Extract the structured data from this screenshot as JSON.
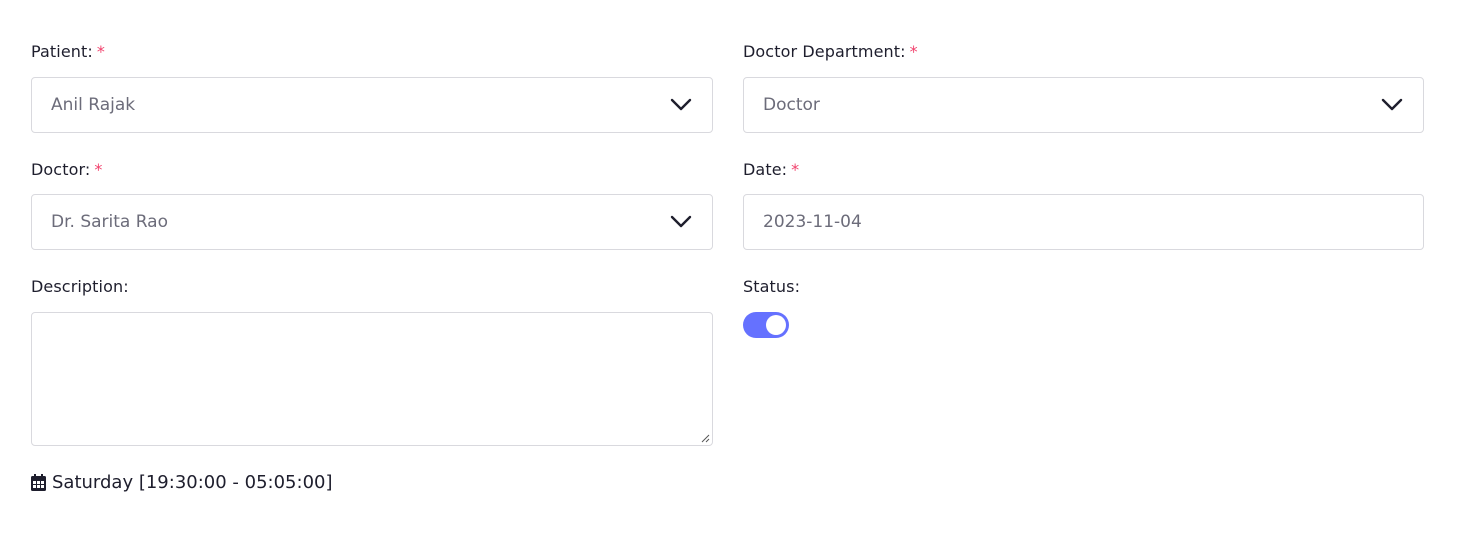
{
  "patient": {
    "label": "Patient:",
    "required_mark": "*",
    "value": "Anil Rajak"
  },
  "doctor_department": {
    "label": "Doctor Department:",
    "required_mark": "*",
    "value": "Doctor"
  },
  "doctor": {
    "label": "Doctor:",
    "required_mark": "*",
    "value": "Dr. Sarita Rao"
  },
  "date": {
    "label": "Date:",
    "required_mark": "*",
    "value": "2023-11-04"
  },
  "description": {
    "label": "Description:",
    "value": ""
  },
  "status": {
    "label": "Status:",
    "enabled": true
  },
  "schedule": {
    "text": "Saturday [19:30:00 - 05:05:00]"
  },
  "colors": {
    "required": "#f1416c",
    "toggle_on": "#6571ff",
    "border": "#d9d9de"
  },
  "icons": {
    "select": "chevron-down-icon",
    "schedule": "calendar-icon",
    "textarea": "resize-grip-icon"
  }
}
